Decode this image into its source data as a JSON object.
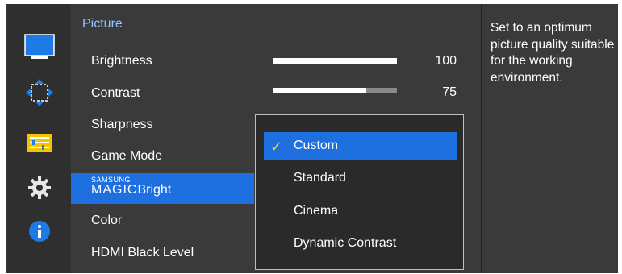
{
  "menu": {
    "title": "Picture",
    "items": [
      {
        "label": "Brightness",
        "value": "100",
        "level": 1.0
      },
      {
        "label": "Contrast",
        "value": "75",
        "level": 0.75
      },
      {
        "label": "Sharpness"
      },
      {
        "label": "Game Mode"
      },
      {
        "label_samsung": "SAMSUNG",
        "label_magic": "MAGIC",
        "label_bright": "Bright"
      },
      {
        "label": "Color"
      },
      {
        "label": "HDMI Black Level"
      }
    ]
  },
  "dropdown": {
    "options": [
      "Custom",
      "Standard",
      "Cinema",
      "Dynamic Contrast"
    ],
    "selected": "Custom",
    "check_glyph": "✓"
  },
  "description": "Set to an optimum picture quality suitable for the working environment.",
  "icons": [
    "monitor-icon",
    "resize-arrows-icon",
    "menu-list-icon",
    "gear-icon",
    "info-icon"
  ],
  "colors": {
    "highlight": "#1e6fe0",
    "header": "#8fc3ff",
    "check": "#ffd400"
  }
}
